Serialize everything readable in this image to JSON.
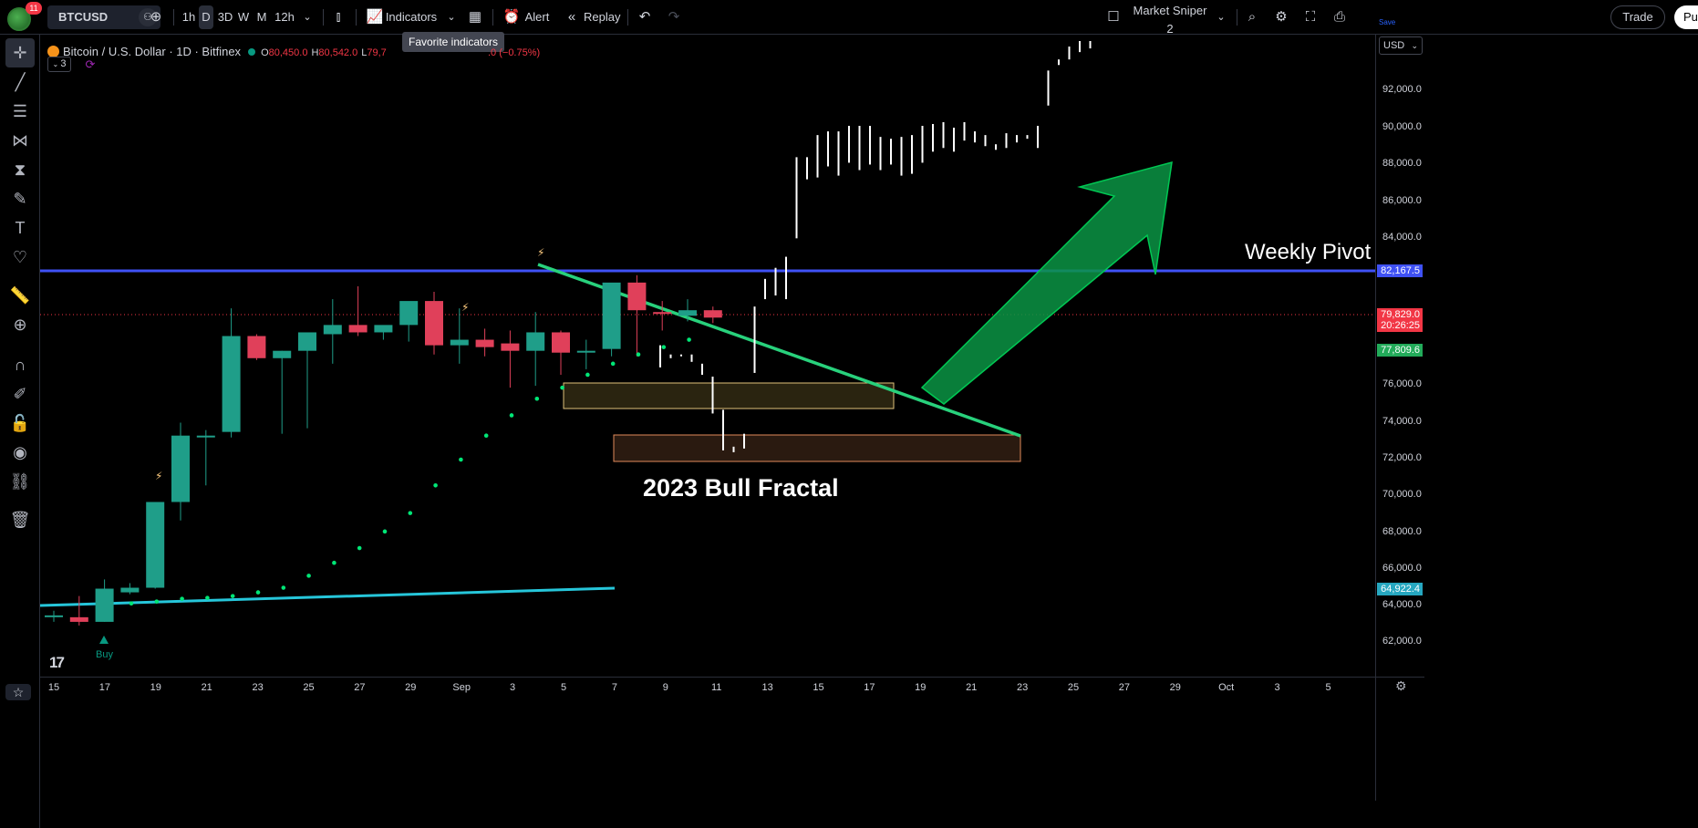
{
  "topbar": {
    "notification_count": "11",
    "symbol": "BTCUSD",
    "timeframes": [
      "1h",
      "D",
      "3D",
      "W",
      "M",
      "12h"
    ],
    "indicators_label": "Indicators",
    "alert_label": "Alert",
    "replay_label": "Replay",
    "layout_name": "Market Sniper 2",
    "layout_save": "Save",
    "trade_label": "Trade",
    "publish_label": "Pu"
  },
  "tooltip": "Favorite indicators",
  "legend": {
    "title": "Bitcoin / U.S. Dollar · 1D · Bitfinex",
    "open_key": "O",
    "open": "80,450.0",
    "high_key": "H",
    "high": "80,542.0",
    "low_key": "L",
    "low": "79,7",
    "change": ".0 (−0.75%)",
    "indicator_count": "3"
  },
  "annotations": {
    "weekly_pivot": "Weekly Pivot",
    "bull_fractal": "2023 Bull Fractal",
    "buy": "Buy"
  },
  "price_axis": {
    "currency": "USD",
    "ticks": [
      "92,000.0",
      "90,000.0",
      "88,000.0",
      "86,000.0",
      "84,000.0",
      "76,000.0",
      "74,000.0",
      "72,000.0",
      "70,000.0",
      "68,000.0",
      "66,000.0",
      "64,000.0",
      "62,000.0"
    ],
    "pivot_price": "82,167.5",
    "last_price": "79,829.0",
    "countdown": "20:26:25",
    "green_price": "77,809.6",
    "blue_price": "64,922.4"
  },
  "time_axis": {
    "ticks": [
      "15",
      "17",
      "19",
      "21",
      "23",
      "25",
      "27",
      "29",
      "Sep",
      "3",
      "5",
      "7",
      "9",
      "11",
      "13",
      "15",
      "17",
      "19",
      "21",
      "23",
      "25",
      "27",
      "29",
      "Oct",
      "3",
      "5"
    ]
  },
  "colors": {
    "up": "#26a69a",
    "up_body": "#1f9e89",
    "down": "#f23645",
    "down_body": "#e0405a",
    "pivot_line": "#3f51f5",
    "trend_line": "#28d17c",
    "support_line": "#26c6da",
    "psar": "#00e676",
    "zone_fill": "#2e2510",
    "zone_border": "#e0b26a",
    "arrow": "#0b9444"
  },
  "chart_data": {
    "type": "candlestick",
    "price_min": 61000,
    "price_max": 94000,
    "candles": [
      {
        "date": "Aug 15",
        "o": 63100,
        "h": 63400,
        "l": 62800,
        "c": 63150
      },
      {
        "date": "Aug 16",
        "o": 63050,
        "h": 64200,
        "l": 62600,
        "c": 62800
      },
      {
        "date": "Aug 17",
        "o": 62800,
        "h": 65100,
        "l": 62800,
        "c": 64600
      },
      {
        "date": "Aug 18",
        "o": 64400,
        "h": 64900,
        "l": 64300,
        "c": 64650
      },
      {
        "date": "Aug 19",
        "o": 64650,
        "h": 65800,
        "l": 64600,
        "c": 69300
      },
      {
        "date": "Aug 20",
        "o": 69300,
        "h": 73600,
        "l": 68300,
        "c": 72900
      },
      {
        "date": "Aug 21",
        "o": 72900,
        "h": 73200,
        "l": 70200,
        "c": 72900
      },
      {
        "date": "Aug 22",
        "o": 73100,
        "h": 79800,
        "l": 72800,
        "c": 78300
      },
      {
        "date": "Aug 23",
        "o": 78300,
        "h": 78400,
        "l": 77000,
        "c": 77100
      },
      {
        "date": "Aug 24",
        "o": 77100,
        "h": 77500,
        "l": 73000,
        "c": 77500
      },
      {
        "date": "Aug 25",
        "o": 77500,
        "h": 78400,
        "l": 73300,
        "c": 78500
      },
      {
        "date": "Aug 26",
        "o": 78400,
        "h": 80300,
        "l": 76800,
        "c": 78900
      },
      {
        "date": "Aug 27",
        "o": 78900,
        "h": 81000,
        "l": 78300,
        "c": 78500
      },
      {
        "date": "Aug 28",
        "o": 78500,
        "h": 78800,
        "l": 78100,
        "c": 78900
      },
      {
        "date": "Aug 29",
        "o": 78900,
        "h": 80000,
        "l": 78000,
        "c": 80200
      },
      {
        "date": "Aug 30",
        "o": 80200,
        "h": 80700,
        "l": 77300,
        "c": 77800
      },
      {
        "date": "Aug 31",
        "o": 77800,
        "h": 79800,
        "l": 76800,
        "c": 78100
      },
      {
        "date": "Sep 1",
        "o": 78100,
        "h": 78700,
        "l": 77200,
        "c": 77700
      },
      {
        "date": "Sep 2",
        "o": 77900,
        "h": 78600,
        "l": 75500,
        "c": 77500
      },
      {
        "date": "Sep 3",
        "o": 77500,
        "h": 79600,
        "l": 75600,
        "c": 78500
      },
      {
        "date": "Sep 4",
        "o": 78500,
        "h": 78600,
        "l": 76200,
        "c": 77400
      },
      {
        "date": "Sep 5",
        "o": 77400,
        "h": 78100,
        "l": 76500,
        "c": 77500
      },
      {
        "date": "Sep 6",
        "o": 77600,
        "h": 80900,
        "l": 77200,
        "c": 81200
      },
      {
        "date": "Sep 7",
        "o": 81200,
        "h": 81600,
        "l": 77200,
        "c": 79700
      },
      {
        "date": "Sep 8",
        "o": 79600,
        "h": 80200,
        "l": 78600,
        "c": 79500
      },
      {
        "date": "Sep 9",
        "o": 79400,
        "h": 80300,
        "l": 79100,
        "c": 79700
      },
      {
        "date": "Sep 10",
        "o": 79700,
        "h": 79900,
        "l": 79000,
        "c": 79300
      }
    ]
  }
}
